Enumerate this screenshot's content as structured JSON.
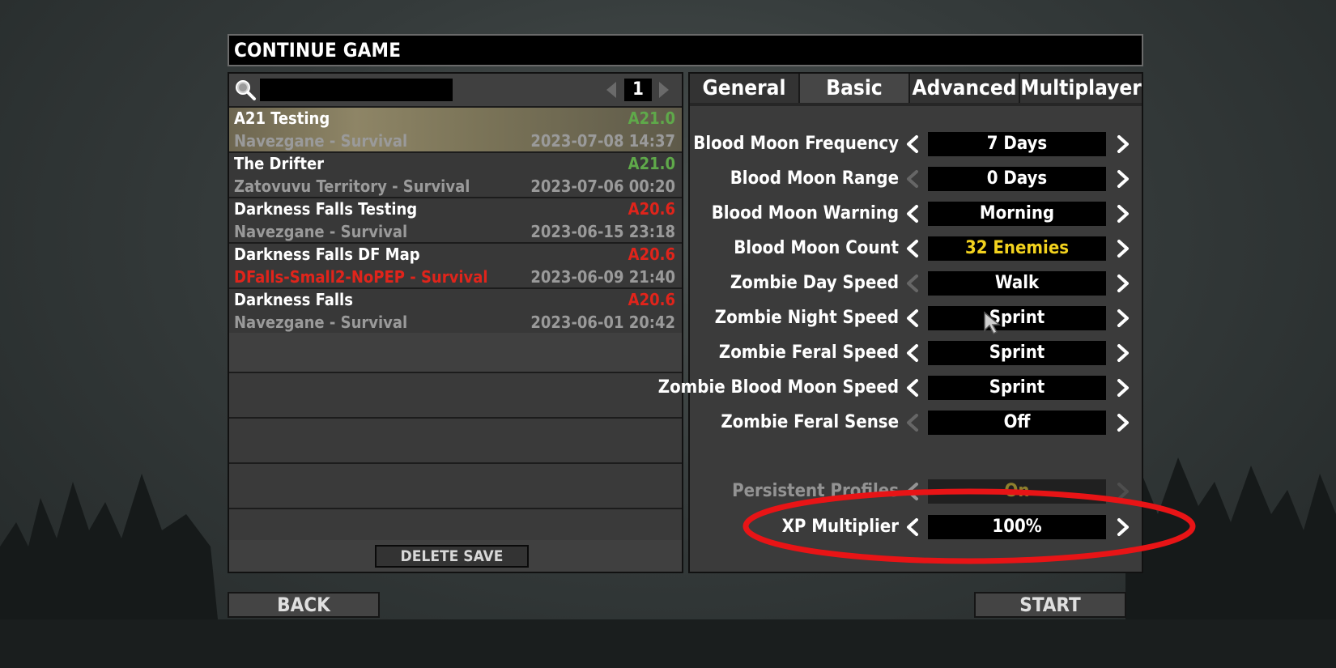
{
  "window": {
    "title": "CONTINUE GAME"
  },
  "search": {
    "value": "",
    "placeholder": ""
  },
  "pager": {
    "page": "1"
  },
  "saves": [
    {
      "name": "A21 Testing",
      "version": "A21.0",
      "version_color": "#5fa94a",
      "world": "Navezgane - Survival",
      "world_color": "#9a9a9a",
      "date": "2023-07-08 14:37",
      "selected": true
    },
    {
      "name": "The Drifter",
      "version": "A21.0",
      "version_color": "#5fa94a",
      "world": "Zatovuvu Territory - Survival",
      "world_color": "#9a9a9a",
      "date": "2023-07-06 00:20",
      "selected": false
    },
    {
      "name": "Darkness Falls Testing",
      "version": "A20.6",
      "version_color": "#e0241b",
      "world": "Navezgane - Survival",
      "world_color": "#9a9a9a",
      "date": "2023-06-15 23:18",
      "selected": false
    },
    {
      "name": "Darkness Falls DF Map",
      "version": "A20.6",
      "version_color": "#e0241b",
      "world": "DFalls-Small2-NoPEP - Survival",
      "world_color": "#e0241b",
      "date": "2023-06-09 21:40",
      "selected": false
    },
    {
      "name": "Darkness Falls",
      "version": "A20.6",
      "version_color": "#e0241b",
      "world": "Navezgane - Survival",
      "world_color": "#9a9a9a",
      "date": "2023-06-01 20:42",
      "selected": false
    }
  ],
  "buttons": {
    "delete_save": "DELETE SAVE",
    "back": "BACK",
    "start": "START"
  },
  "tabs": [
    {
      "label": "General",
      "active": false
    },
    {
      "label": "Basic",
      "active": true
    },
    {
      "label": "Advanced",
      "active": false
    },
    {
      "label": "Multiplayer",
      "active": false
    }
  ],
  "options": [
    {
      "label": "Blood Moon Frequency",
      "value": "7 Days",
      "value_color": "#ffffff",
      "left_enabled": true,
      "right_enabled": true
    },
    {
      "label": "Blood Moon Range",
      "value": "0 Days",
      "value_color": "#ffffff",
      "left_enabled": false,
      "right_enabled": true
    },
    {
      "label": "Blood Moon Warning",
      "value": "Morning",
      "value_color": "#ffffff",
      "left_enabled": true,
      "right_enabled": true
    },
    {
      "label": "Blood Moon Count",
      "value": "32 Enemies",
      "value_color": "#f2d21e",
      "left_enabled": true,
      "right_enabled": true
    },
    {
      "label": "Zombie Day Speed",
      "value": "Walk",
      "value_color": "#ffffff",
      "left_enabled": false,
      "right_enabled": true
    },
    {
      "label": "Zombie Night Speed",
      "value": "Sprint",
      "value_color": "#ffffff",
      "left_enabled": true,
      "right_enabled": true
    },
    {
      "label": "Zombie Feral Speed",
      "value": "Sprint",
      "value_color": "#ffffff",
      "left_enabled": true,
      "right_enabled": true
    },
    {
      "label": "Zombie Blood Moon Speed",
      "value": "Sprint",
      "value_color": "#ffffff",
      "left_enabled": true,
      "right_enabled": true
    },
    {
      "label": "Zombie Feral Sense",
      "value": "Off",
      "value_color": "#ffffff",
      "left_enabled": false,
      "right_enabled": true
    }
  ],
  "options_lower": [
    {
      "label": "Persistent Profiles",
      "value": "On",
      "value_color": "#f2d21e",
      "left_enabled": true,
      "right_enabled": false,
      "faded": true
    },
    {
      "label": "XP Multiplier",
      "value": "100%",
      "value_color": "#ffffff",
      "left_enabled": true,
      "right_enabled": true,
      "faded": false
    }
  ],
  "annotation": {
    "color": "#e81416"
  }
}
